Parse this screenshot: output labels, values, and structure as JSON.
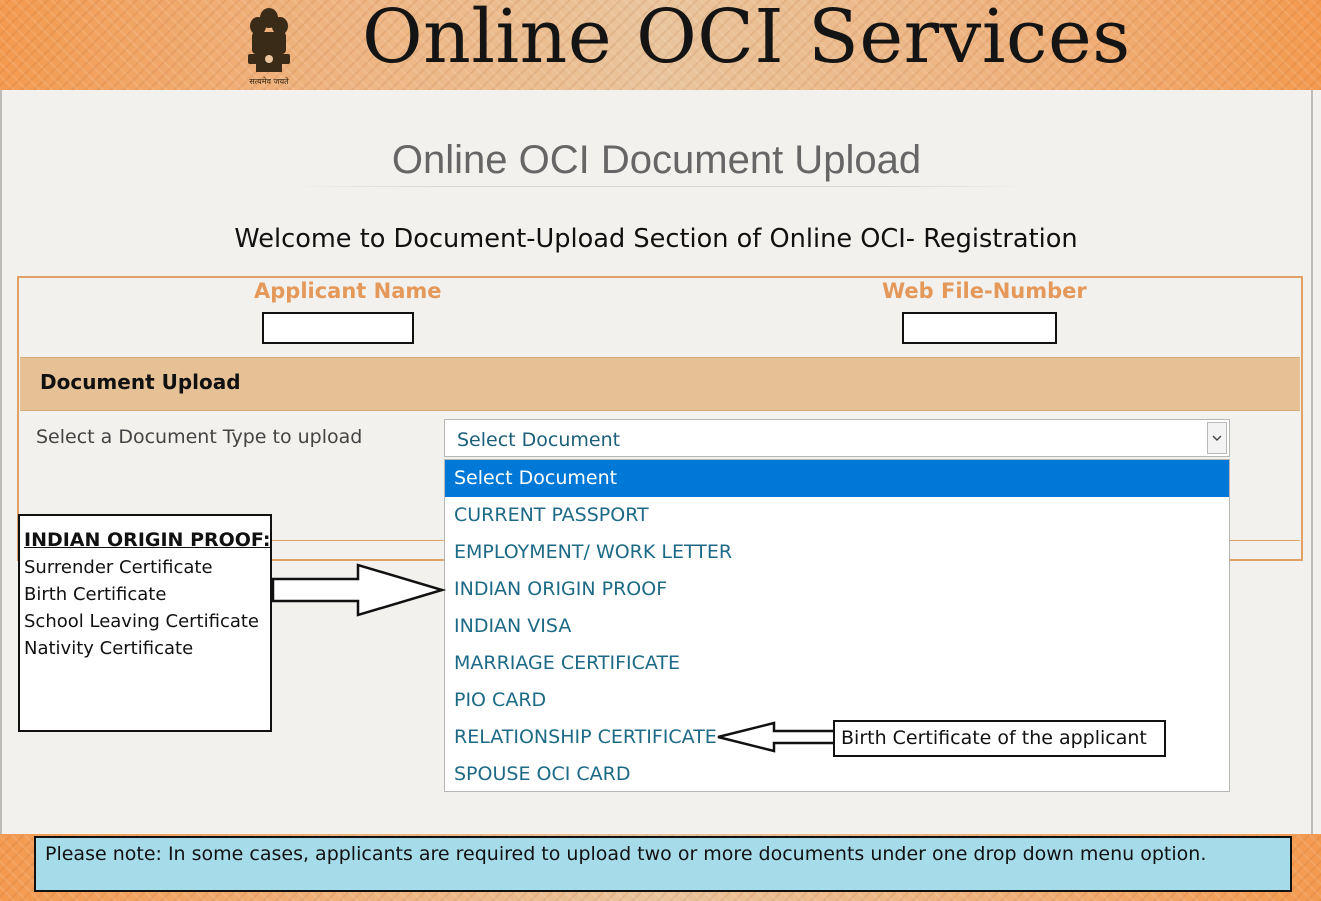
{
  "header": {
    "title": "Online OCI Services",
    "emblem_motto": "सत्यमेव जयते"
  },
  "page": {
    "title": "Online OCI Document Upload",
    "welcome": "Welcome to Document-Upload Section of Online OCI- Registration"
  },
  "form": {
    "applicant_name_label": "Applicant Name",
    "applicant_name_value": "",
    "web_file_number_label": "Web File-Number",
    "web_file_number_value": "",
    "section_title": "Document Upload",
    "select_label": "Select a Document Type to upload",
    "select_value": "Select Document",
    "options": [
      "Select Document",
      "CURRENT PASSPORT",
      "EMPLOYMENT/ WORK LETTER",
      "INDIAN ORIGIN PROOF",
      "INDIAN VISA",
      "MARRIAGE CERTIFICATE",
      "PIO CARD",
      "RELATIONSHIP CERTIFICATE",
      "SPOUSE OCI CARD"
    ],
    "highlighted_option": "Select Document"
  },
  "callouts": {
    "indian_origin": {
      "title": "INDIAN ORIGIN PROOF:",
      "items": [
        "Surrender Certificate",
        "Birth Certificate",
        "School Leaving Certificate",
        "Nativity Certificate"
      ]
    },
    "relationship": "Birth Certificate of the applicant"
  },
  "footer": {
    "note": "Please note: In some cases, applicants are required to upload two or more documents under one drop down menu option."
  },
  "colors": {
    "banner_orange": "#f39a4f",
    "field_label": "#e4985a",
    "section_bar": "#e6c196",
    "option_text": "#1d6a87",
    "option_selected": "#0078d7",
    "footer_note_bg": "#a6dcea"
  }
}
